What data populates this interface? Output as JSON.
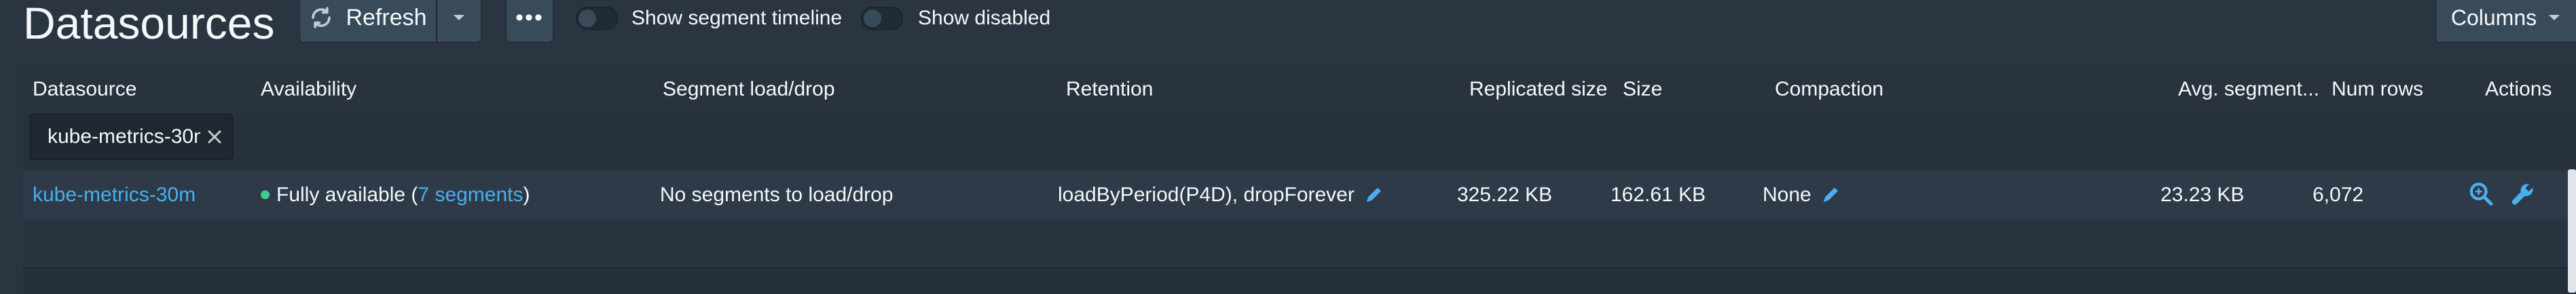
{
  "header": {
    "title": "Datasources",
    "refresh_label": "Refresh",
    "more_label": "•••",
    "toggle_segment_timeline": "Show segment timeline",
    "toggle_show_disabled": "Show disabled",
    "columns_label": "Columns"
  },
  "table": {
    "columns": [
      "Datasource",
      "Availability",
      "Segment load/drop",
      "Retention",
      "Replicated size",
      "Size",
      "Compaction",
      "Avg. segment...",
      "Num rows",
      "Actions"
    ],
    "filter_value": "kube-metrics-30m",
    "rows": [
      {
        "datasource": "kube-metrics-30m",
        "availability_prefix": "Fully available (",
        "availability_link": "7 segments",
        "availability_suffix": ")",
        "segment_load_drop": "No segments to load/drop",
        "retention": "loadByPeriod(P4D), dropForever",
        "replicated_size": "325.22 KB",
        "size": "162.61 KB",
        "compaction": "None",
        "avg_segment": "23.23 KB",
        "num_rows": "6,072"
      }
    ]
  },
  "colors": {
    "background": "#2b3542",
    "link": "#48aff0",
    "status_ok": "#3dcc91"
  },
  "icons": [
    "refresh-icon",
    "caret-down-icon",
    "more-icon",
    "close-icon",
    "edit-icon",
    "search-icon",
    "wrench-icon"
  ]
}
